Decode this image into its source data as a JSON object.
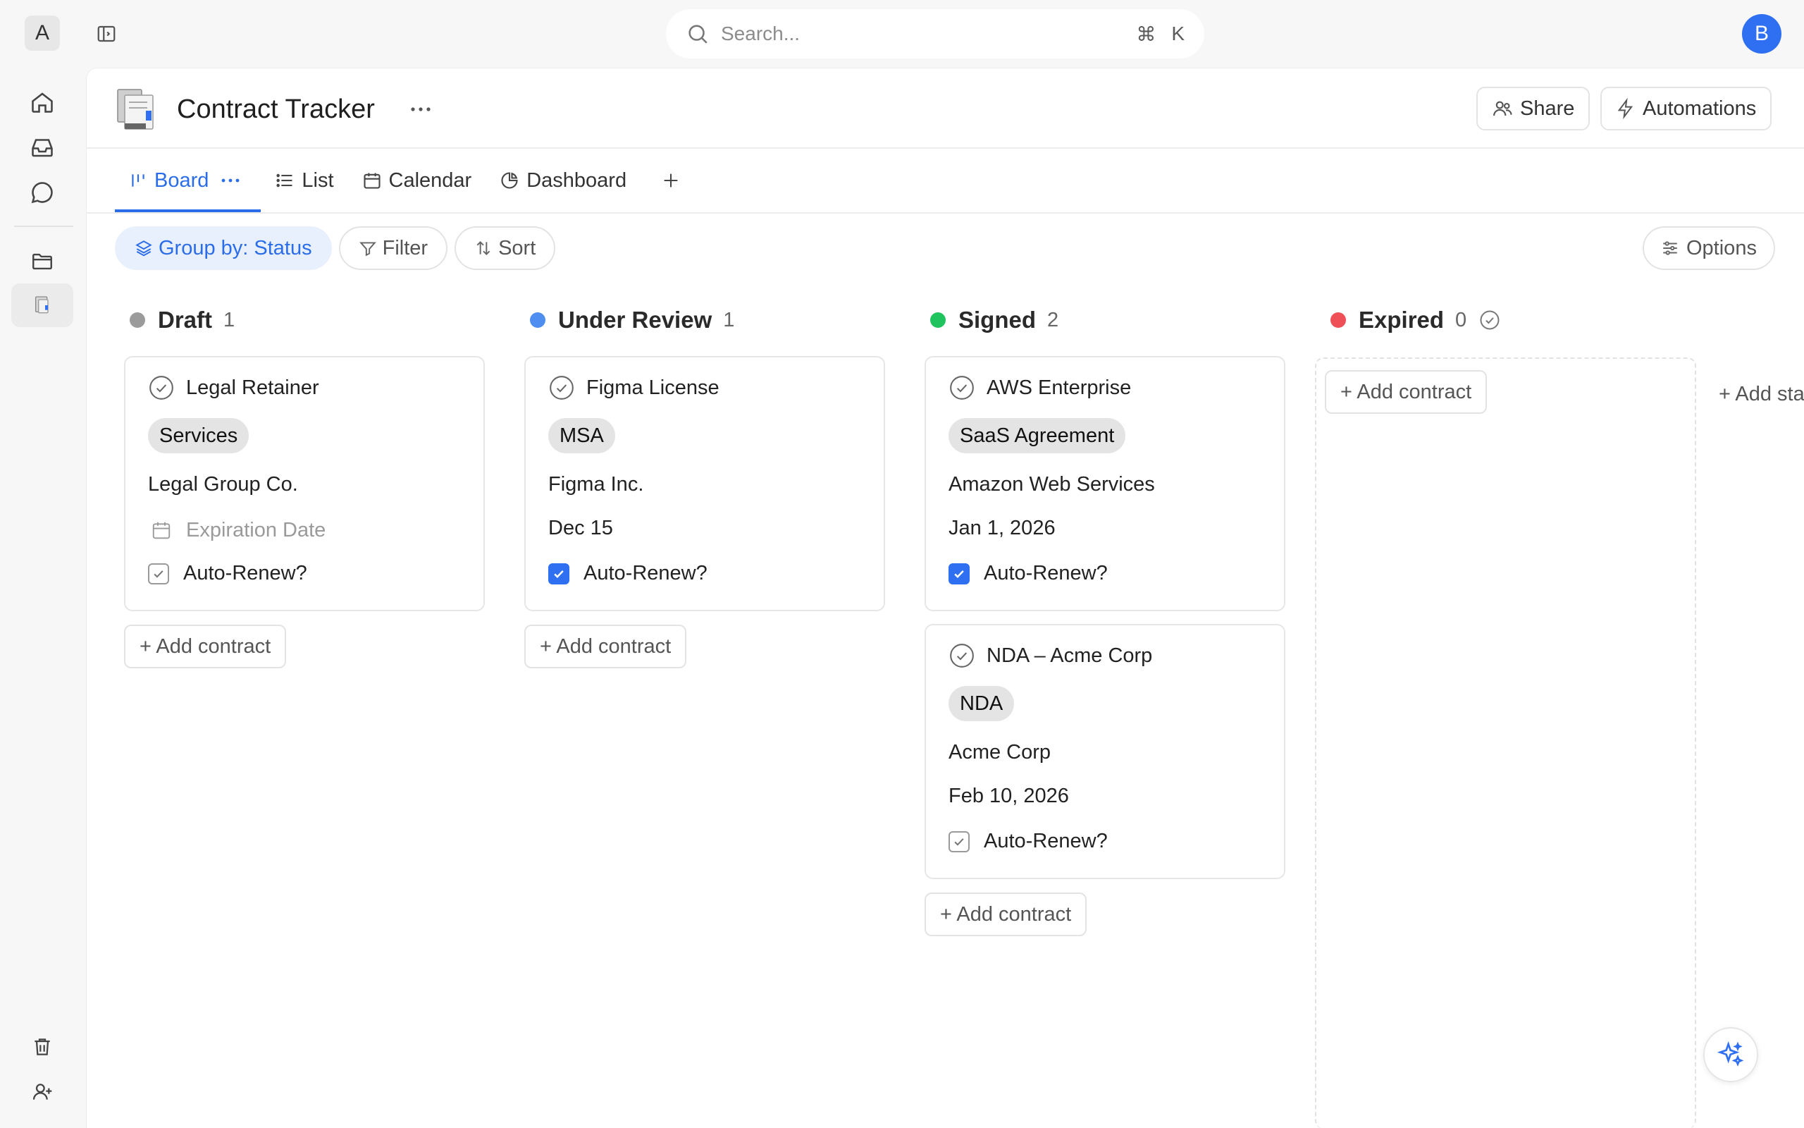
{
  "topbar": {
    "workspace_initial": "A",
    "search_placeholder": "Search...",
    "shortcut_cmd": "⌘",
    "shortcut_key": "K",
    "avatar_initial": "B"
  },
  "page": {
    "title": "Contract Tracker",
    "share_label": "Share",
    "automations_label": "Automations"
  },
  "tabs": [
    {
      "label": "Board",
      "active": true
    },
    {
      "label": "List"
    },
    {
      "label": "Calendar"
    },
    {
      "label": "Dashboard"
    }
  ],
  "toolbar": {
    "group_by": "Group by: Status",
    "filter": "Filter",
    "sort": "Sort",
    "options": "Options"
  },
  "columns": [
    {
      "title": "Draft",
      "count": "1",
      "color": "#9b9b9b"
    },
    {
      "title": "Under Review",
      "count": "1",
      "color": "#4e8ef0"
    },
    {
      "title": "Signed",
      "count": "2",
      "color": "#1fc45f"
    },
    {
      "title": "Expired",
      "count": "0",
      "color": "#ef4f56"
    }
  ],
  "cards": [
    {
      "title": "Legal Retainer",
      "tag": "Services",
      "company": "Legal Group Co.",
      "date": "Expiration Date",
      "auto_renew_label": "Auto-Renew?",
      "auto_renew": false
    },
    {
      "title": "Figma License",
      "tag": "MSA",
      "company": "Figma Inc.",
      "date": "Dec 15",
      "auto_renew_label": "Auto-Renew?",
      "auto_renew": true
    },
    {
      "title": "AWS Enterprise",
      "tag": "SaaS Agreement",
      "company": "Amazon Web Services",
      "date": "Jan 1, 2026",
      "auto_renew_label": "Auto-Renew?",
      "auto_renew": true
    },
    {
      "title": "NDA – Acme Corp",
      "tag": "NDA",
      "company": "Acme Corp",
      "date": "Feb 10, 2026",
      "auto_renew_label": "Auto-Renew?",
      "auto_renew": false
    }
  ],
  "add_contract_label": "+ Add contract",
  "add_status_label": "+ Add sta"
}
